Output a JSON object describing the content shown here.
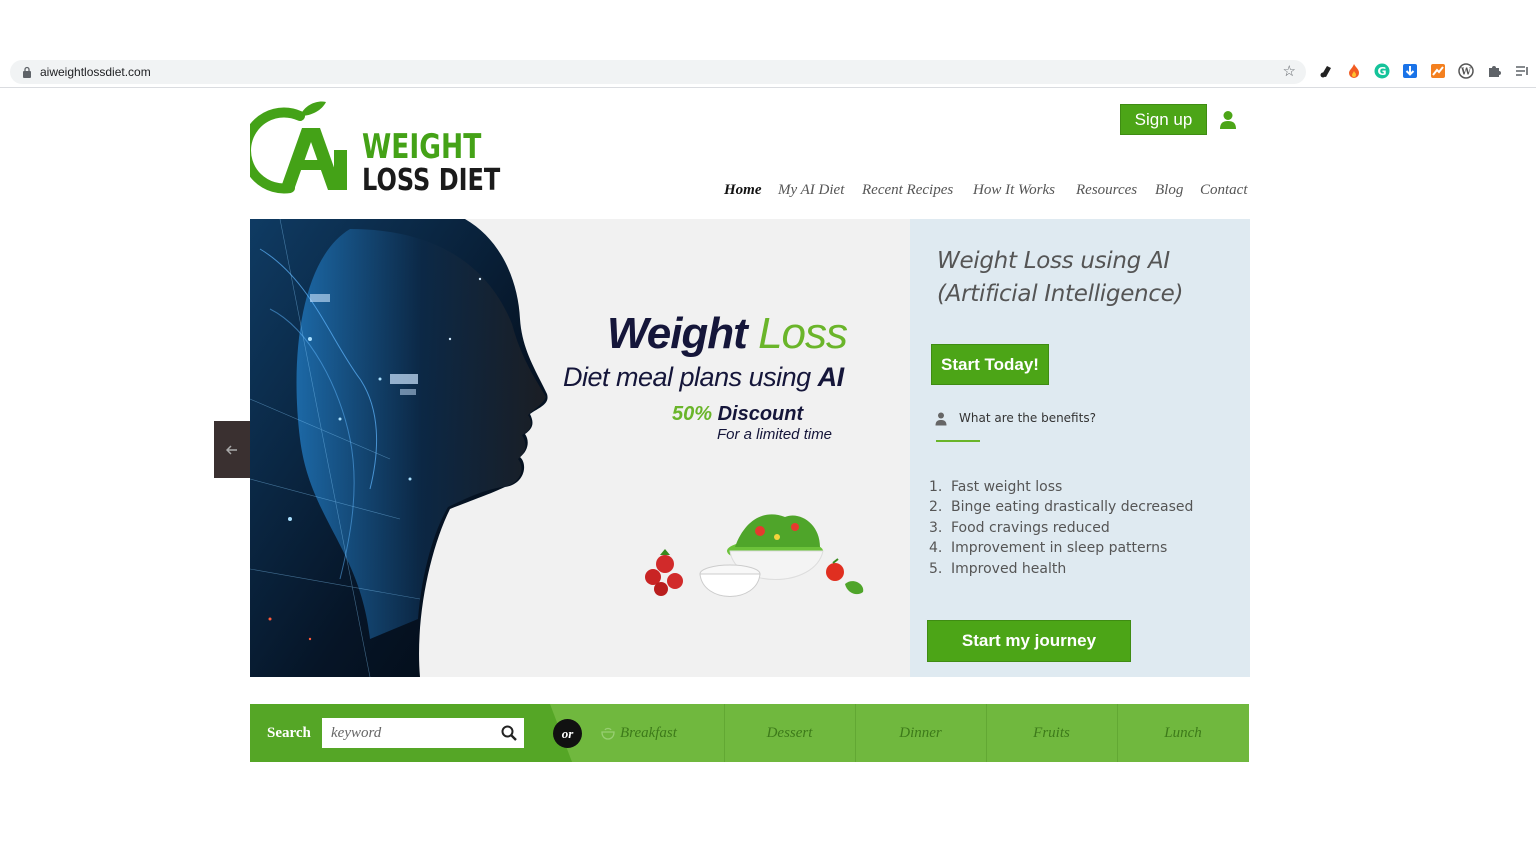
{
  "browser": {
    "url": "aiweightlossdiet.com"
  },
  "logo": {
    "line1": "WEIGHT",
    "line2": "LOSS DIET"
  },
  "header": {
    "signup_label": "Sign up"
  },
  "nav": {
    "items": [
      {
        "label": "Home"
      },
      {
        "label": "My AI Diet"
      },
      {
        "label": "Recent Recipes"
      },
      {
        "label": "How It Works"
      },
      {
        "label": "Resources"
      },
      {
        "label": "Blog"
      },
      {
        "label": "Contact"
      }
    ]
  },
  "hero": {
    "title_part1": "Weight",
    "title_part2": "Loss",
    "subtitle_part1": "Diet meal plans using",
    "subtitle_part2": "AI",
    "discount_pct": "50%",
    "discount_word": "Discount",
    "limited": "For a limited time"
  },
  "panel": {
    "title_line1": "Weight Loss using AI",
    "title_line2": "(Artificial Intelligence)",
    "start_today_label": "Start Today!",
    "benefits_question": "What are the benefits?",
    "benefits": [
      {
        "num": "1.",
        "text": "Fast weight loss"
      },
      {
        "num": "2.",
        "text": "Binge eating drastically decreased"
      },
      {
        "num": "3.",
        "text": "Food cravings reduced"
      },
      {
        "num": "4.",
        "text": "Improvement in sleep patterns"
      },
      {
        "num": "5.",
        "text": "Improved health"
      }
    ],
    "journey_label": "Start my journey"
  },
  "searchbar": {
    "label": "Search",
    "placeholder": "keyword",
    "or_label": "or",
    "categories": [
      {
        "label": "Breakfast"
      },
      {
        "label": "Dessert"
      },
      {
        "label": "Dinner"
      },
      {
        "label": "Fruits"
      },
      {
        "label": "Lunch"
      }
    ]
  },
  "colors": {
    "brand_green": "#4ca517",
    "bar_green": "#70b83e",
    "panel_bg": "#dfeaf1",
    "navy": "#15163a"
  }
}
